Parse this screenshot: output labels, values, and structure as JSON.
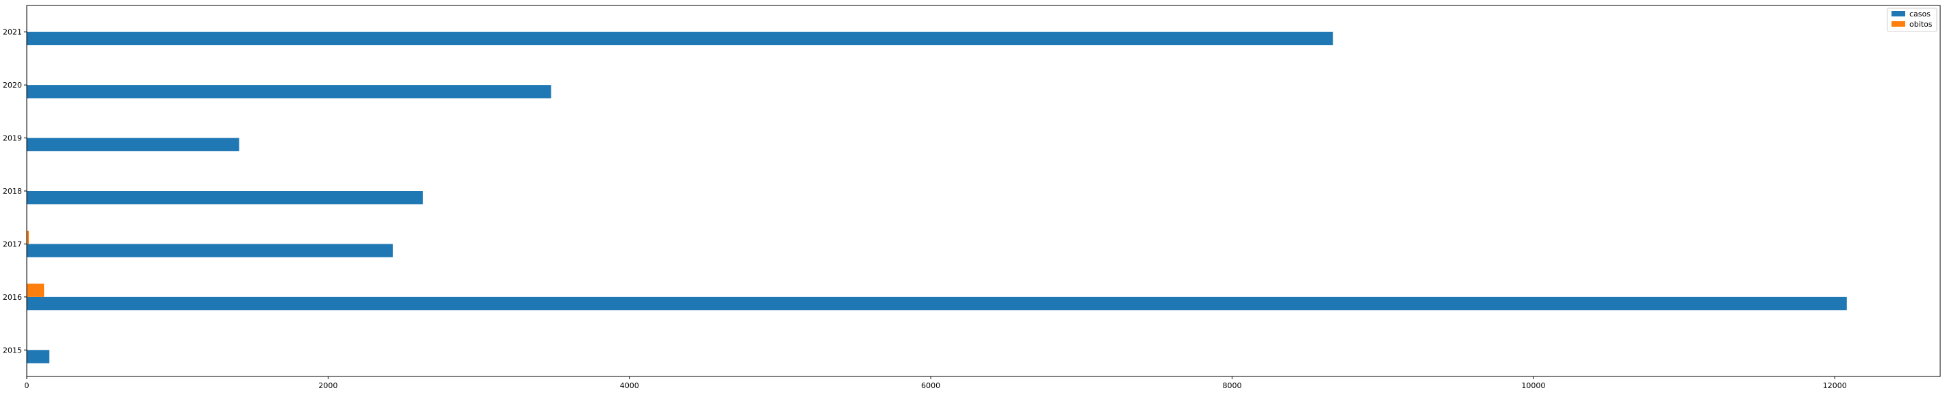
{
  "chart_data": {
    "type": "bar",
    "orientation": "horizontal",
    "categories": [
      "2015",
      "2016",
      "2017",
      "2018",
      "2019",
      "2020",
      "2021"
    ],
    "series": [
      {
        "name": "casos",
        "color": "#1f77b4",
        "values": [
          150,
          12080,
          2430,
          2630,
          1410,
          3480,
          8670
        ]
      },
      {
        "name": "obitos",
        "color": "#ff7f0e",
        "values": [
          0,
          115,
          14,
          0,
          0,
          0,
          0
        ]
      }
    ],
    "x_ticks": [
      0,
      2000,
      4000,
      6000,
      8000,
      10000,
      12000
    ],
    "xlim": [
      0,
      12700
    ],
    "title": "",
    "xlabel": "",
    "ylabel": "",
    "grid": false,
    "legend_position": "top-right"
  }
}
